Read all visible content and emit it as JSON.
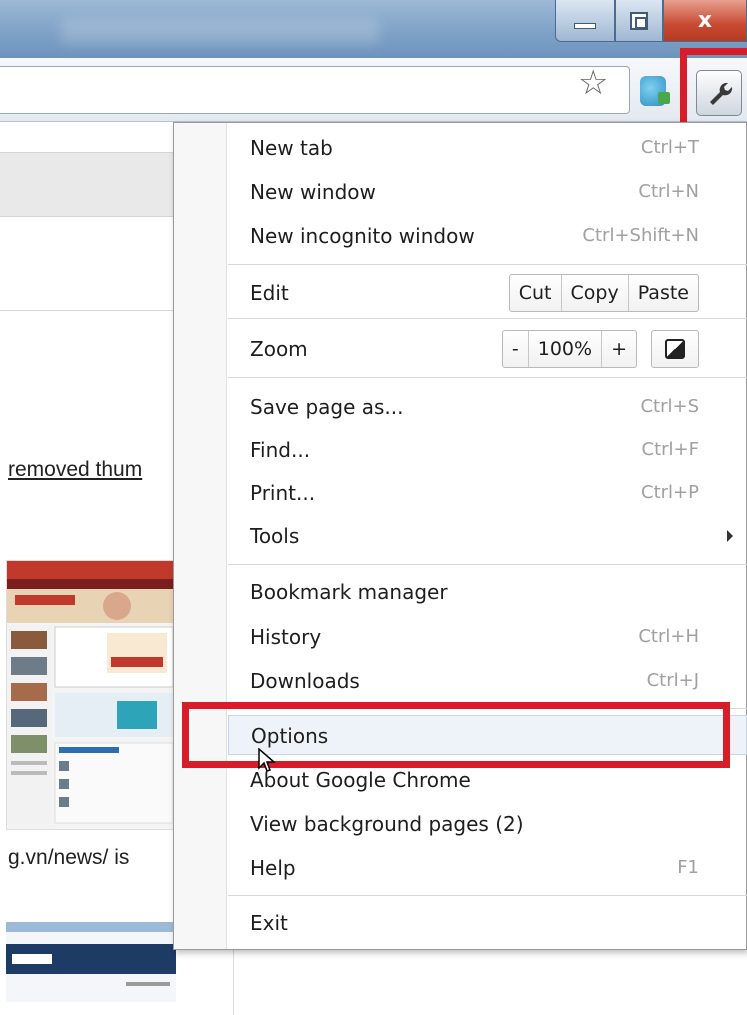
{
  "window": {
    "buttons": {
      "minimize": "minimize",
      "maximize": "maximize",
      "close": "x"
    }
  },
  "toolbar": {
    "icons": [
      "star-icon",
      "extension-icon",
      "wrench-icon"
    ]
  },
  "page": {
    "link_text": "removed thum",
    "url_text": "g.vn/news/ is"
  },
  "menu": {
    "items": [
      {
        "label": "New tab",
        "shortcut": "Ctrl+T"
      },
      {
        "label": "New window",
        "shortcut": "Ctrl+N"
      },
      {
        "label": "New incognito window",
        "shortcut": "Ctrl+Shift+N"
      },
      {
        "label": "Edit",
        "buttons": [
          "Cut",
          "Copy",
          "Paste"
        ]
      },
      {
        "label": "Zoom",
        "buttons": [
          "-",
          "100%",
          "+"
        ]
      },
      {
        "label": "Save page as...",
        "shortcut": "Ctrl+S"
      },
      {
        "label": "Find...",
        "shortcut": "Ctrl+F"
      },
      {
        "label": "Print...",
        "shortcut": "Ctrl+P"
      },
      {
        "label": "Tools"
      },
      {
        "label": "Bookmark manager"
      },
      {
        "label": "History",
        "shortcut": "Ctrl+H"
      },
      {
        "label": "Downloads",
        "shortcut": "Ctrl+J"
      },
      {
        "label": "Options"
      },
      {
        "label": "About Google Chrome"
      },
      {
        "label": "View background pages (2)"
      },
      {
        "label": "Help",
        "shortcut": "F1"
      },
      {
        "label": "Exit"
      }
    ]
  },
  "colors": {
    "highlight": "#d71d2a",
    "titlebar": "#7fa2c7",
    "shortcut_text": "#a0a0a0"
  }
}
